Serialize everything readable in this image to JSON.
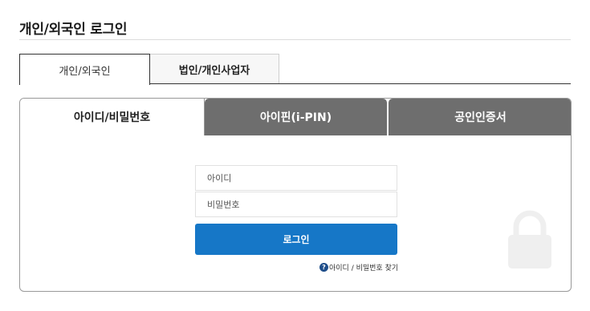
{
  "page": {
    "title": "개인/외국인 로그인"
  },
  "member_tabs": [
    {
      "label": "개인/외국인",
      "active": true
    },
    {
      "label": "법인/개인사업자",
      "active": false
    }
  ],
  "login_tabs": [
    {
      "label": "아이디/비밀번호",
      "active": true
    },
    {
      "label": "아이핀(i-PIN)",
      "active": false
    },
    {
      "label": "공인인증서",
      "active": false
    }
  ],
  "form": {
    "id_placeholder": "아이디",
    "password_placeholder": "비밀번호",
    "login_label": "로그인",
    "find_link_label": "아이디 / 비밀번호 찾기",
    "find_link_icon": "?"
  },
  "colors": {
    "accent": "#1677c7",
    "inactive_tab": "#6e6e6e",
    "help_icon": "#1f4e8a"
  },
  "icons": {
    "help": "help-icon",
    "watermark": "lock-icon"
  }
}
